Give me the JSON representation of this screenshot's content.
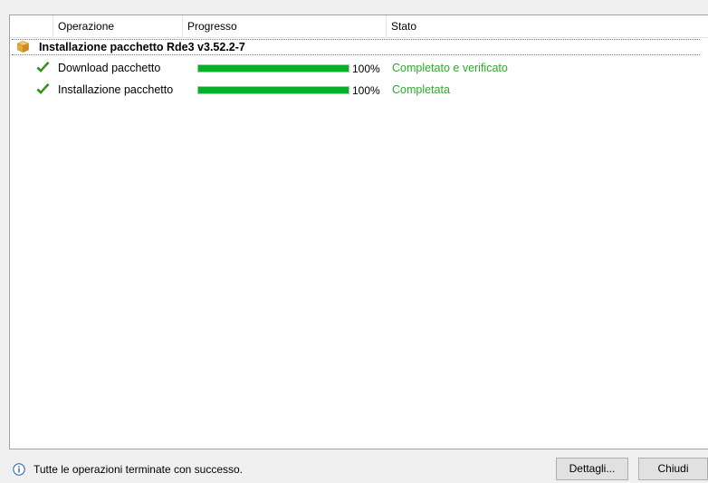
{
  "columns": {
    "operation": "Operazione",
    "progress": "Progresso",
    "status": "Stato"
  },
  "group": {
    "title": "Installazione pacchetto Rde3 v3.52.2-7",
    "icon": "package-icon"
  },
  "rows": [
    {
      "icon": "checkmark-icon",
      "label": "Download pacchetto",
      "progress": 1.0,
      "percent_text": "100%",
      "status": "Completato e verificato"
    },
    {
      "icon": "checkmark-icon",
      "label": "Installazione pacchetto",
      "progress": 1.0,
      "percent_text": "100%",
      "status": "Completata"
    }
  ],
  "footer": {
    "info_icon": "info-icon",
    "message": "Tutte le operazioni terminate con successo.",
    "details_button": "Dettagli...",
    "close_button": "Chiudi"
  },
  "colors": {
    "progress_fill": "#06b025",
    "status_text": "#2ea82e",
    "check": "#3a9a1a"
  }
}
